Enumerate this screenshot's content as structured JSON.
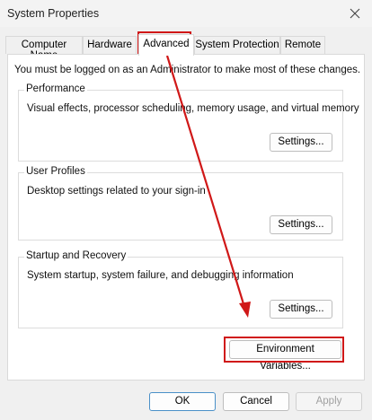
{
  "window": {
    "title": "System Properties"
  },
  "tabs": [
    {
      "label": "Computer Name"
    },
    {
      "label": "Hardware"
    },
    {
      "label": "Advanced"
    },
    {
      "label": "System Protection"
    },
    {
      "label": "Remote"
    }
  ],
  "admin_note": "You must be logged on as an Administrator to make most of these changes.",
  "groups": {
    "performance": {
      "title": "Performance",
      "description": "Visual effects, processor scheduling, memory usage, and virtual memory",
      "button": "Settings..."
    },
    "user_profiles": {
      "title": "User Profiles",
      "description": "Desktop settings related to your sign-in",
      "button": "Settings..."
    },
    "startup_recovery": {
      "title": "Startup and Recovery",
      "description": "System startup, system failure, and debugging information",
      "button": "Settings..."
    }
  },
  "env_button": "Environment Variables...",
  "footer": {
    "ok": "OK",
    "cancel": "Cancel",
    "apply": "Apply"
  },
  "annotation_color": "#d01818",
  "icons": {
    "close": "close-icon"
  }
}
